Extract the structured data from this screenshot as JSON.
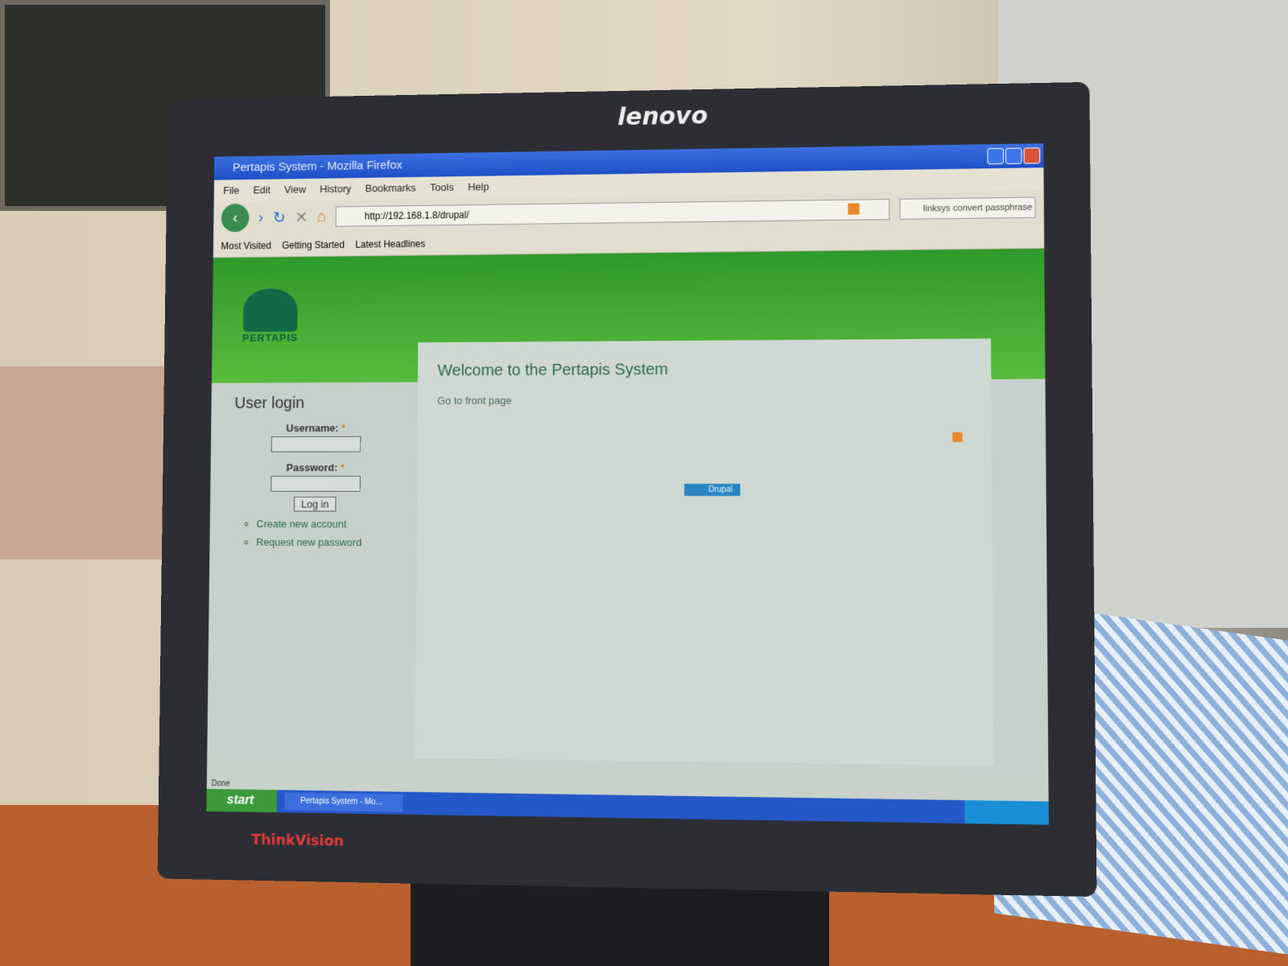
{
  "monitor": {
    "brand": "lenovo",
    "model": "ThinkVision"
  },
  "window": {
    "title": "Pertapis System - Mozilla Firefox"
  },
  "menu": [
    "File",
    "Edit",
    "View",
    "History",
    "Bookmarks",
    "Tools",
    "Help"
  ],
  "nav": {
    "url": "http://192.168.1.8/drupal/",
    "search_value": "linksys convert passphrase"
  },
  "bookmarks": [
    "Most Visited",
    "Getting Started",
    "Latest Headlines"
  ],
  "site": {
    "logo_text": "PERTAPIS",
    "welcome": "Welcome to the Pertapis System",
    "front_link": "Go to front page",
    "drupal_badge": "Drupal"
  },
  "login": {
    "title": "User login",
    "username_label": "Username:",
    "password_label": "Password:",
    "required": "*",
    "button": "Log in",
    "links": [
      "Create new account",
      "Request new password"
    ]
  },
  "status": "Done",
  "taskbar": {
    "start": "start",
    "task": "Pertapis System - Mo..."
  }
}
